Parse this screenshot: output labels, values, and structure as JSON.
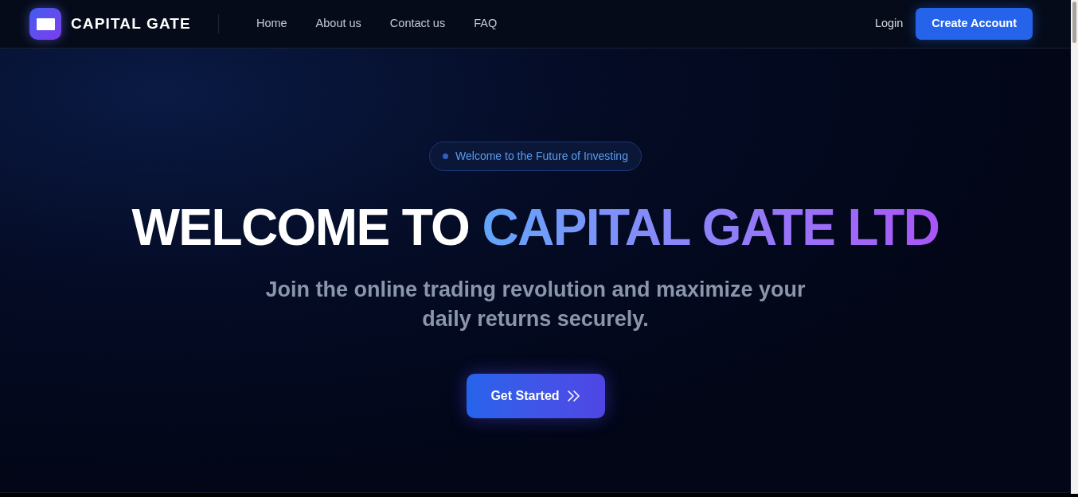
{
  "header": {
    "brand": "CAPITAL GATE",
    "nav": [
      "Home",
      "About us",
      "Contact us",
      "FAQ"
    ],
    "login": "Login",
    "cta": "Create Account"
  },
  "hero": {
    "badge": "Welcome to the Future of Investing",
    "headline": {
      "plain": "WELCOME TO",
      "highlight": "CAPITAL GATE LTD"
    },
    "subtitle": "Join the online trading revolution and maximize your daily returns securely.",
    "button": "Get Started"
  }
}
